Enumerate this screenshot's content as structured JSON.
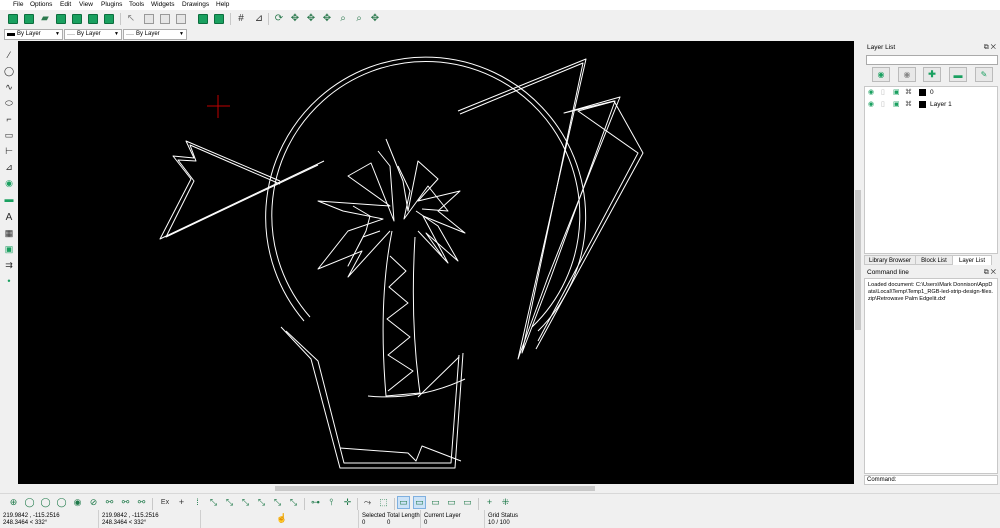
{
  "menu": [
    "File",
    "Options",
    "Edit",
    "View",
    "Plugins",
    "Tools",
    "Widgets",
    "Drawings",
    "Help"
  ],
  "pen": {
    "color": "By Layer",
    "width": "By Layer",
    "type": "By Layer"
  },
  "layer_dock": {
    "title": "Layer List",
    "layers": [
      {
        "name": "0",
        "color": "#000000"
      },
      {
        "name": "Layer 1",
        "color": "#000000"
      }
    ],
    "tabs": [
      "Library Browser",
      "Block List",
      "Layer List"
    ]
  },
  "command_dock": {
    "title": "Command line",
    "history": "Loaded document: C:\\Users\\Mark Donnison\\AppData\\Local\\Temp\\Temp1_RGB-led-strip-design-files.zip\\Retrowave Palm Edgelit.dxf",
    "prompt": "Command:"
  },
  "snap": {
    "exclusive_label": "Ex"
  },
  "status": {
    "abs_coord": "219.9842 , -115.2516",
    "abs_polar": "248.3464 < 332°",
    "rel_coord": "219.9842 , -115.2516",
    "rel_polar": "248.3464 < 332°",
    "selected_label": "Selected",
    "selected_value": "0",
    "total_length_label": "Total Length",
    "total_length_value": "0",
    "current_layer_label": "Current Layer",
    "current_layer_value": "0",
    "grid_status_label": "Grid Status",
    "grid_status_value": "10 / 100"
  },
  "colors": {
    "canvas_bg": "#000000",
    "drawing_line": "#ffffff",
    "crosshair": "#c00000",
    "accent_green": "#1aa060"
  },
  "icons": [
    "new-icon",
    "new-template-icon",
    "open-icon",
    "save-icon",
    "save-as-icon",
    "print-icon",
    "print-preview-icon",
    "select-pointer-icon",
    "grid-icon",
    "crosshair-icon",
    "eye-icon",
    "lock-icon",
    "print-layer-icon",
    "construction-icon",
    "add-layer-icon",
    "remove-layer-icon",
    "edit-layer-icon"
  ]
}
